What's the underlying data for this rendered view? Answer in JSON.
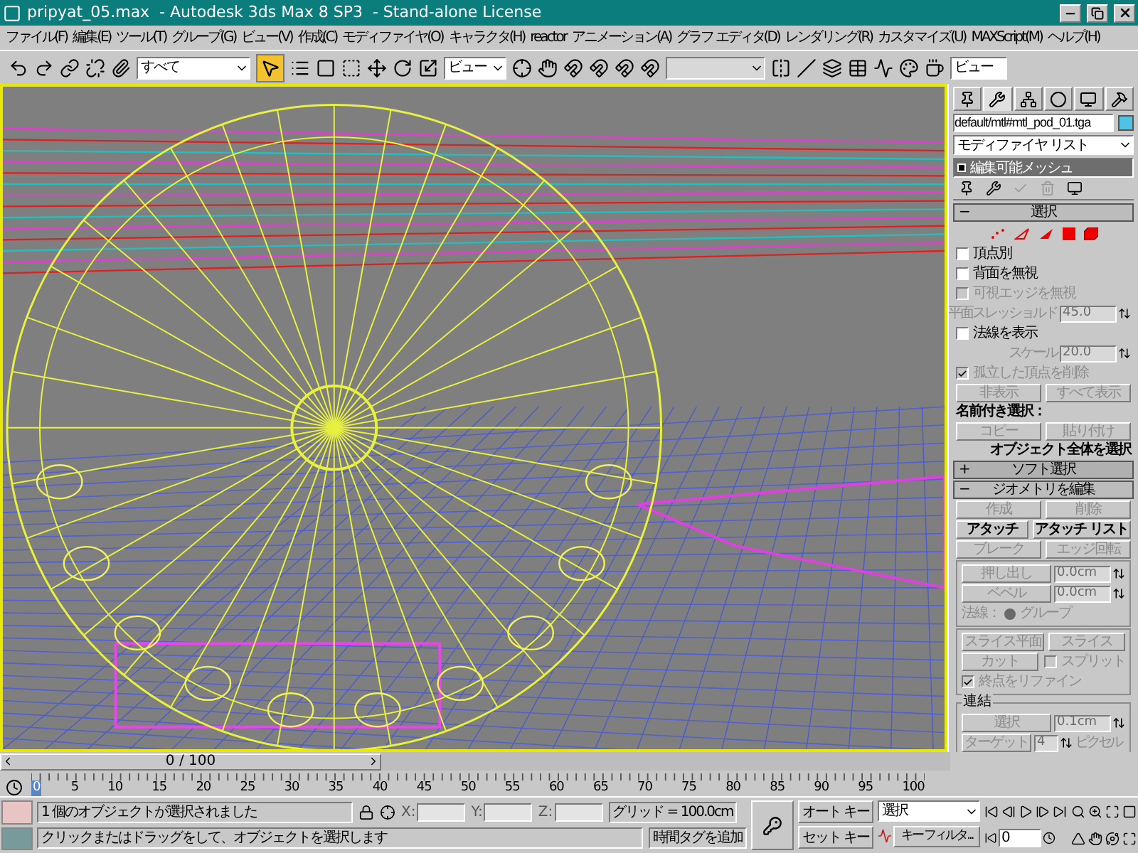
{
  "window": {
    "title": "pripyat_05.max  - Autodesk 3ds Max 8 SP3  - Stand-alone License"
  },
  "menu": [
    "ファイル(F)",
    "編集(E)",
    "ツール(T)",
    "グループ(G)",
    "ビュー(V)",
    "作成(C)",
    "モディファイヤ(O)",
    "キャラクタ(H)",
    "reactor",
    "アニメーション(A)",
    "グラフ エディタ(D)",
    "レンダリング(R)",
    "カスタマイズ(U)",
    "MAXScript(M)",
    "ヘルプ(H)"
  ],
  "toolbar": {
    "selection_filter": "すべて",
    "select_tool_selected": true,
    "reference_coordinate": "ビュー",
    "render_preset": "ビュー"
  },
  "command_panel": {
    "tabs": [
      {
        "kind": "create",
        "selected": false
      },
      {
        "kind": "modify",
        "selected": true
      },
      {
        "kind": "hierarchy",
        "selected": false
      },
      {
        "kind": "motion",
        "selected": false
      },
      {
        "kind": "display",
        "selected": false
      },
      {
        "kind": "utilities",
        "selected": false
      }
    ],
    "object_name": "default/mtl#mtl_pod_01.tga",
    "modifier_list": "モディファイヤ リスト",
    "stack": [
      {
        "label": "編集可能メッシュ",
        "selected": true
      }
    ],
    "rollouts": [
      {
        "title": "選択",
        "sign": "−",
        "expanded": true,
        "items": [
          {
            "kind": "subobjects"
          },
          {
            "kind": "checkbox",
            "label": "頂点別",
            "checked": false,
            "disabled": false
          },
          {
            "kind": "checkbox",
            "label": "背面を無視",
            "checked": false,
            "disabled": false
          },
          {
            "kind": "checkbox",
            "label": "可視エッジを無視",
            "checked": false,
            "disabled": true
          },
          {
            "kind": "spinner",
            "label": "平面スレッショルド",
            "value": "45.0",
            "disabled": true
          },
          {
            "kind": "checkbox",
            "label": "法線を表示",
            "checked": false,
            "disabled": false
          },
          {
            "kind": "spinner",
            "label": "スケール",
            "value": "20.0",
            "disabled": true
          },
          {
            "kind": "checkbox",
            "label": "孤立した頂点を削除",
            "checked": true,
            "disabled": true
          },
          {
            "kind": "buttons",
            "buttons": [
              {
                "label": "非表示",
                "disabled": true
              },
              {
                "label": "すべて表示",
                "disabled": true
              }
            ]
          },
          {
            "kind": "label",
            "text": "名前付き選択："
          },
          {
            "kind": "buttons",
            "buttons": [
              {
                "label": "コピー",
                "disabled": true
              },
              {
                "label": "貼り付け",
                "disabled": true
              }
            ]
          },
          {
            "kind": "note",
            "text": "オブジェクト全体を選択"
          }
        ]
      },
      {
        "title": "ソフト選択",
        "sign": "+",
        "expanded": false
      },
      {
        "title": "ジオメトリを編集",
        "sign": "−",
        "expanded": true,
        "items": [
          {
            "kind": "buttons",
            "buttons": [
              {
                "label": "作成",
                "disabled": true
              },
              {
                "label": "削除",
                "disabled": true
              }
            ]
          },
          {
            "kind": "buttons",
            "buttons": [
              {
                "label": "アタッチ",
                "disabled": false
              },
              {
                "label": "アタッチ リスト",
                "disabled": false
              }
            ]
          },
          {
            "kind": "buttons",
            "buttons": [
              {
                "label": "ブレーク",
                "disabled": true
              },
              {
                "label": "エッジ回転",
                "disabled": true
              }
            ]
          },
          {
            "kind": "group",
            "items": [
              {
                "kind": "button_spinner",
                "label": "押し出し",
                "value": "0.0cm",
                "disabled": true
              },
              {
                "kind": "button_spinner",
                "label": "ベベル",
                "value": "0.0cm",
                "disabled": true
              },
              {
                "kind": "radio",
                "label": "法線：",
                "option": "グループ",
                "selected": true,
                "disabled": true
              }
            ]
          },
          {
            "kind": "group",
            "items": [
              {
                "kind": "buttons",
                "buttons": [
                  {
                    "label": "スライス平面",
                    "disabled": true
                  },
                  {
                    "label": "スライス",
                    "disabled": true
                  }
                ]
              },
              {
                "kind": "button_checkbox",
                "button": {
                  "label": "カット",
                  "disabled": true
                },
                "checkbox": {
                  "label": "スプリット",
                  "checked": false,
                  "disabled": true
                }
              },
              {
                "kind": "checkbox",
                "label": "終点をリファイン",
                "checked": true,
                "disabled": true
              }
            ]
          },
          {
            "kind": "group",
            "title": "連結",
            "items": [
              {
                "kind": "button_spinner",
                "label": "選択",
                "value": "0.1cm",
                "disabled": true
              },
              {
                "kind": "button_spinner",
                "label": "ターゲット",
                "value": "4",
                "unit": "ピクセル",
                "disabled": true
              }
            ]
          }
        ]
      }
    ]
  },
  "timeline": {
    "slider": {
      "label": "0 / 100",
      "level": 0
    },
    "ruler": [
      "0",
      "5",
      "10",
      "15",
      "20",
      "25",
      "30",
      "35",
      "40",
      "45",
      "50",
      "55",
      "60",
      "65",
      "70",
      "75",
      "80",
      "85",
      "90",
      "95",
      "100"
    ]
  },
  "status": {
    "selection_message": "1 個のオブジェクトが選択されました",
    "prompt": "クリックまたはドラッグをして、オブジェクトを選択します",
    "coords": [
      "X:",
      "Y:",
      "Z:"
    ],
    "grid": "グリッド = 100.0cm",
    "time_tag": "時間タグを追加"
  },
  "animation": {
    "auto_key": "オート キー",
    "set_key": "セット キー",
    "key_set": "選択",
    "key_filters": "キー フィルタ...",
    "frame": "0"
  }
}
